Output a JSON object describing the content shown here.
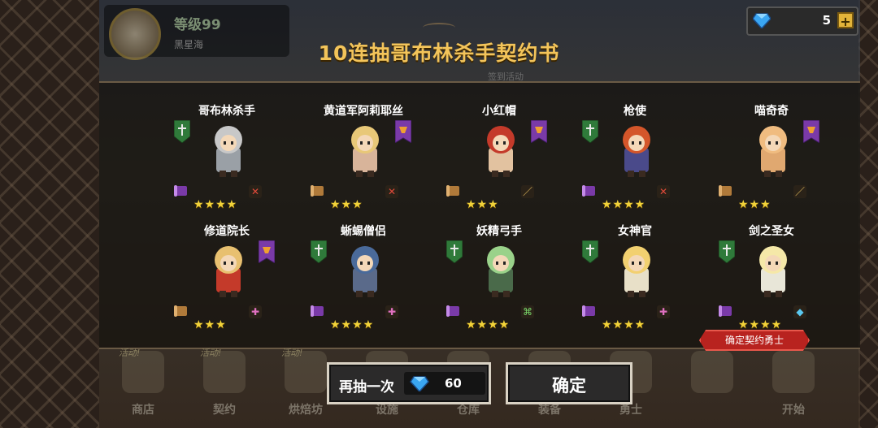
{
  "player": {
    "level": "等级99",
    "name": "黑星海"
  },
  "currency": {
    "diamonds": "5",
    "plus_label": "+"
  },
  "title": "10连抽哥布林杀手契约书",
  "background_text": {
    "event": "签到活动"
  },
  "heroes": [
    {
      "name": "哥布林杀手",
      "stars": "★★★★",
      "class_icon": "warrior-shield-icon",
      "rarity": "purple-scroll-icon",
      "weapon": "sword-icon",
      "colors": {
        "body": "#9aa0a6",
        "head": "#c8c8c8"
      }
    },
    {
      "name": "黄道军阿莉耶丝",
      "stars": "★★★",
      "class_icon": "mage-banner-icon",
      "rarity": "brown-scroll-icon",
      "weapon": "sword-icon",
      "colors": {
        "body": "#d8b49a",
        "head": "#e8c878"
      }
    },
    {
      "name": "小红帽",
      "stars": "★★★",
      "class_icon": "mage-banner-icon",
      "rarity": "brown-scroll-icon",
      "weapon": "wand-icon",
      "colors": {
        "body": "#e2c2a0",
        "head": "#c43a2a"
      }
    },
    {
      "name": "枪使",
      "stars": "★★★★",
      "class_icon": "warrior-shield-icon",
      "rarity": "purple-scroll-icon",
      "weapon": "sword-icon",
      "colors": {
        "body": "#4a4a8a",
        "head": "#d4562a"
      }
    },
    {
      "name": "喵奇奇",
      "stars": "★★★",
      "class_icon": "mage-banner-icon",
      "rarity": "brown-scroll-icon",
      "weapon": "wand-icon",
      "colors": {
        "body": "#e0a870",
        "head": "#f0bc80"
      }
    },
    {
      "name": "修道院长",
      "stars": "★★★",
      "class_icon": "mage-banner-icon",
      "rarity": "brown-scroll-icon",
      "weapon": "healer-icon",
      "colors": {
        "body": "#c43a2a",
        "head": "#e8c070"
      }
    },
    {
      "name": "蜥蜴僧侣",
      "stars": "★★★★",
      "class_icon": "warrior-shield-icon",
      "rarity": "purple-scroll-icon",
      "weapon": "healer-icon",
      "colors": {
        "body": "#5a6a8a",
        "head": "#4a6a9a"
      }
    },
    {
      "name": "妖精弓手",
      "stars": "★★★★",
      "class_icon": "warrior-shield-icon",
      "rarity": "purple-scroll-icon",
      "weapon": "bow-icon",
      "colors": {
        "body": "#4a6a4a",
        "head": "#9ad28a"
      }
    },
    {
      "name": "女神官",
      "stars": "★★★★",
      "class_icon": "warrior-shield-icon",
      "rarity": "purple-scroll-icon",
      "weapon": "healer-icon",
      "colors": {
        "body": "#e8e0c8",
        "head": "#f2d070"
      }
    },
    {
      "name": "剑之圣女",
      "stars": "★★★★",
      "class_icon": "warrior-shield-icon",
      "rarity": "purple-scroll-icon",
      "weapon": "gem-icon",
      "colors": {
        "body": "#e8e6d8",
        "head": "#f5e8a8"
      }
    }
  ],
  "tag": "确定契约勇士",
  "nav": [
    {
      "label": "商店",
      "hot": "活动!"
    },
    {
      "label": "契约",
      "hot": "活动!"
    },
    {
      "label": "烘焙坊",
      "hot": "活动!"
    },
    {
      "label": "设施",
      "hot": ""
    },
    {
      "label": "仓库",
      "hot": ""
    },
    {
      "label": "装备",
      "hot": ""
    },
    {
      "label": "勇士",
      "hot": ""
    },
    {
      "label": "",
      "hot": ""
    },
    {
      "label": "开始",
      "hot": ""
    }
  ],
  "buttons": {
    "again": "再抽一次",
    "cost": "60",
    "confirm": "确定"
  },
  "colors": {
    "title": "#f3c45a",
    "stars": "#f2d33a",
    "tag": "#b8231f",
    "purple": "#7a3aa8",
    "green": "#2f7a3a"
  }
}
